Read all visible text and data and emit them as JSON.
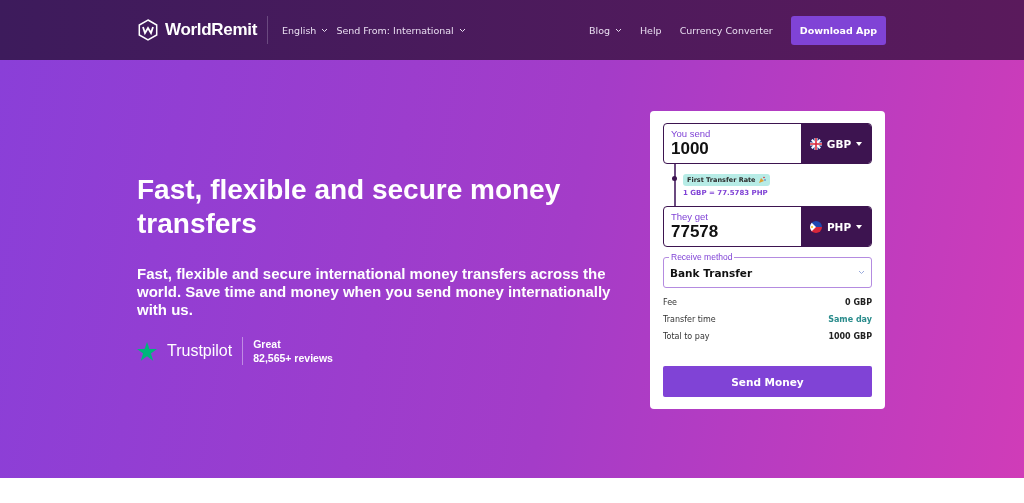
{
  "header": {
    "logo": "WorldRemit",
    "language": {
      "label": "English"
    },
    "send_from": {
      "label": "Send From: International"
    },
    "nav": [
      {
        "label": "Blog",
        "dropdown": true
      },
      {
        "label": "Help",
        "dropdown": false
      },
      {
        "label": "Currency Converter",
        "dropdown": false
      }
    ],
    "cta": "Download App"
  },
  "hero": {
    "title": "Fast, flexible and secure money transfers",
    "subtitle": "Fast, flexible and secure international money transfers across the world. Save time and money when you send money internationally with us.",
    "trustpilot": {
      "brand": "Trustpilot",
      "rating": "Great",
      "reviews": "82,565+ reviews"
    }
  },
  "calculator": {
    "send": {
      "label": "You send",
      "value": "1000",
      "currency": "GBP"
    },
    "rate_badge": "First Transfer Rate",
    "rate": "1 GBP = 77.5783 PHP",
    "receive": {
      "label": "They get",
      "value": "77578",
      "currency": "PHP"
    },
    "method": {
      "label": "Receive method",
      "value": "Bank Transfer"
    },
    "summary": [
      {
        "label": "Fee",
        "value": "0 GBP",
        "kind": "plain"
      },
      {
        "label": "Transfer time",
        "value": "Same day",
        "kind": "highlight"
      },
      {
        "label": "Total to pay",
        "value": "1000 GBP",
        "kind": "plain"
      }
    ],
    "submit": "Send Money"
  }
}
